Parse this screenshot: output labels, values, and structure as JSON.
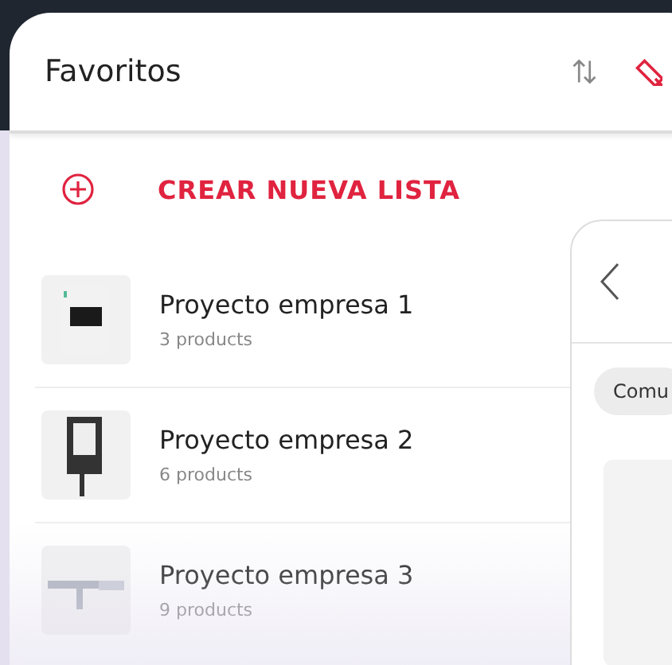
{
  "header": {
    "title": "Favoritos"
  },
  "create_list": {
    "label": "CREAR NUEVA LISTA"
  },
  "lists": [
    {
      "name": "Proyecto empresa 1",
      "count": "3 products"
    },
    {
      "name": "Proyecto empresa 2",
      "count": "6 products"
    },
    {
      "name": "Proyecto empresa 3",
      "count": "9 products"
    }
  ],
  "detail_panel": {
    "chip": "Comu"
  }
}
